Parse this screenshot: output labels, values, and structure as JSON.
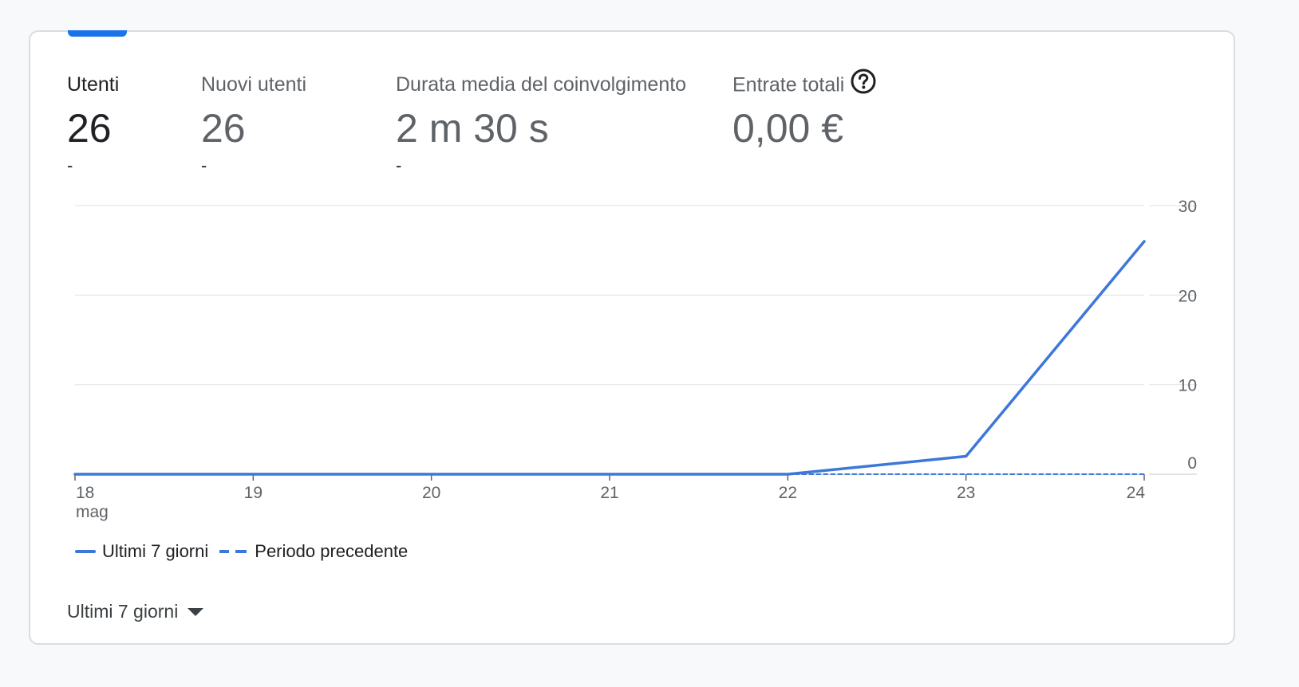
{
  "metrics": [
    {
      "label": "Utenti",
      "value": "26",
      "delta": "-",
      "active": true
    },
    {
      "label": "Nuovi utenti",
      "value": "26",
      "delta": "-"
    },
    {
      "label": "Durata media del coinvolgimento",
      "value": "2 m 30 s",
      "delta": "-"
    },
    {
      "label": "Entrate totali",
      "value": "0,00 €",
      "delta": "",
      "icon": "help-icon"
    }
  ],
  "colors": {
    "accent": "#1a73e8",
    "series": "#3c78d8",
    "grid": "#e8eaed"
  },
  "chart_data": {
    "type": "line",
    "x": [
      "18 mag",
      "19",
      "20",
      "21",
      "22",
      "23",
      "24"
    ],
    "x_tick_labels": [
      {
        "line1": "18",
        "line2": "mag"
      },
      {
        "line1": "19"
      },
      {
        "line1": "20"
      },
      {
        "line1": "21"
      },
      {
        "line1": "22"
      },
      {
        "line1": "23"
      },
      {
        "line1": "24"
      }
    ],
    "series": [
      {
        "name": "Ultimi 7 giorni",
        "style": "solid",
        "values": [
          0,
          0,
          0,
          0,
          0,
          2,
          26
        ]
      },
      {
        "name": "Periodo precedente",
        "style": "dashed",
        "values": [
          null,
          null,
          null,
          null,
          0,
          0,
          0
        ]
      }
    ],
    "y_ticks": [
      0,
      10,
      20,
      30
    ],
    "ylim": [
      0,
      30
    ],
    "y_axis_side": "right",
    "grid": true,
    "legend_position": "bottom-left"
  },
  "legend": {
    "current_label": "Ultimi 7 giorni",
    "previous_label": "Periodo precedente"
  },
  "range_selector": {
    "label": "Ultimi 7 giorni"
  }
}
